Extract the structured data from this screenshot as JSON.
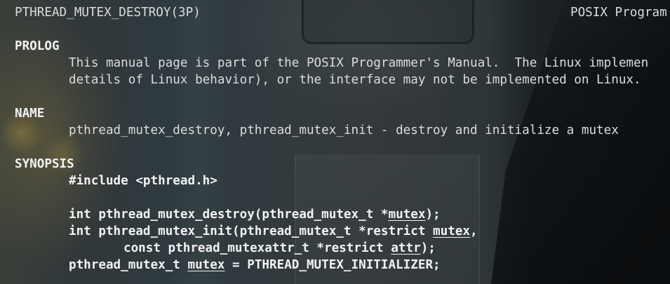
{
  "header": {
    "left": "PTHREAD_MUTEX_DESTROY(3P)",
    "right": "POSIX Program"
  },
  "prolog": {
    "heading": "PROLOG",
    "line1": "This manual page is part of the POSIX Programmer's Manual.  The Linux implemen",
    "line2": "details of Linux behavior), or the interface may not be implemented on Linux."
  },
  "name": {
    "heading": "NAME",
    "line1": "pthread_mutex_destroy, pthread_mutex_init - destroy and initialize a mutex"
  },
  "synopsis": {
    "heading": "SYNOPSIS",
    "include": "#include <pthread.h>",
    "destroy": {
      "prefix": "int pthread_mutex_destroy(pthread_mutex_t *",
      "arg": "mutex",
      "suffix": ");"
    },
    "init": {
      "prefix": "int pthread_mutex_init(pthread_mutex_t *restrict ",
      "arg": "mutex",
      "suffix": ","
    },
    "init2": {
      "prefix": "const pthread_mutexattr_t *restrict ",
      "arg": "attr",
      "suffix": ");"
    },
    "initializer": {
      "prefix": "pthread_mutex_t ",
      "arg": "mutex",
      "suffix": " = PTHREAD_MUTEX_INITIALIZER;"
    }
  }
}
